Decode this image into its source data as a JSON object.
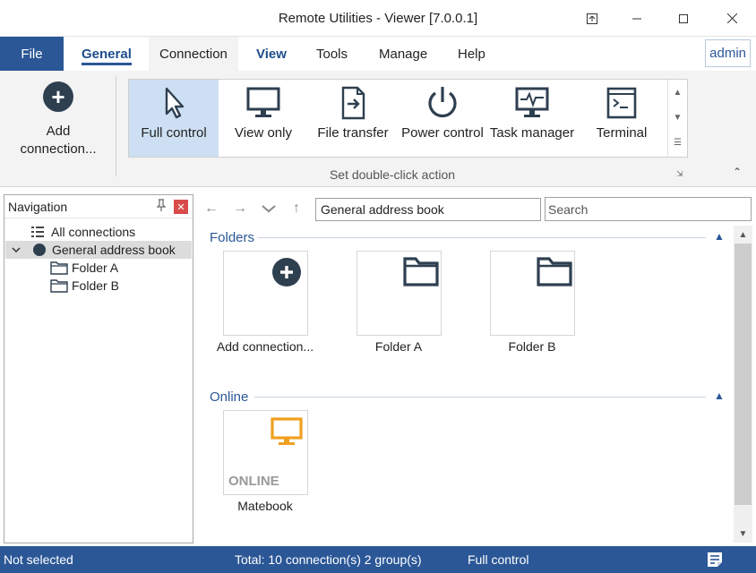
{
  "window": {
    "title": "Remote Utilities - Viewer [7.0.0.1]"
  },
  "menu": {
    "file": "File",
    "tabs": [
      "General",
      "Connection",
      "View",
      "Tools",
      "Manage",
      "Help"
    ],
    "active_tab": "General",
    "user": "admin"
  },
  "ribbon": {
    "add_connection": "Add connection...",
    "actions": [
      {
        "label": "Full control",
        "icon": "cursor-icon",
        "selected": true
      },
      {
        "label": "View only",
        "icon": "monitor-icon",
        "selected": false
      },
      {
        "label": "File transfer",
        "icon": "file-transfer-icon",
        "selected": false
      },
      {
        "label": "Power control",
        "icon": "power-icon",
        "selected": false
      },
      {
        "label": "Task manager",
        "icon": "task-manager-icon",
        "selected": false
      },
      {
        "label": "Terminal",
        "icon": "terminal-icon",
        "selected": false
      }
    ],
    "group_label": "Set double-click action"
  },
  "navigation": {
    "title": "Navigation",
    "tree": [
      {
        "label": "All connections",
        "icon": "list-icon"
      },
      {
        "label": "General address book",
        "icon": "address-book-icon"
      },
      {
        "label": "Folder A",
        "icon": "folder-icon"
      },
      {
        "label": "Folder B",
        "icon": "folder-icon"
      }
    ]
  },
  "addressbar": {
    "path": "General address book",
    "search_placeholder": "Search"
  },
  "content": {
    "folders_title": "Folders",
    "folders": [
      {
        "label": "Add connection...",
        "icon": "add-icon"
      },
      {
        "label": "Folder A",
        "icon": "folder-icon"
      },
      {
        "label": "Folder B",
        "icon": "folder-icon"
      }
    ],
    "online_title": "Online",
    "online": [
      {
        "label": "Matebook",
        "badge": "ONLINE",
        "icon": "monitor-icon",
        "color": "#f0a020"
      }
    ]
  },
  "status": {
    "selection": "Not selected",
    "total": "Total: 10 connection(s) 2 group(s)",
    "mode": "Full control"
  },
  "colors": {
    "accent": "#2b5797",
    "icon_dark": "#2e3f50",
    "online": "#f0a020"
  }
}
